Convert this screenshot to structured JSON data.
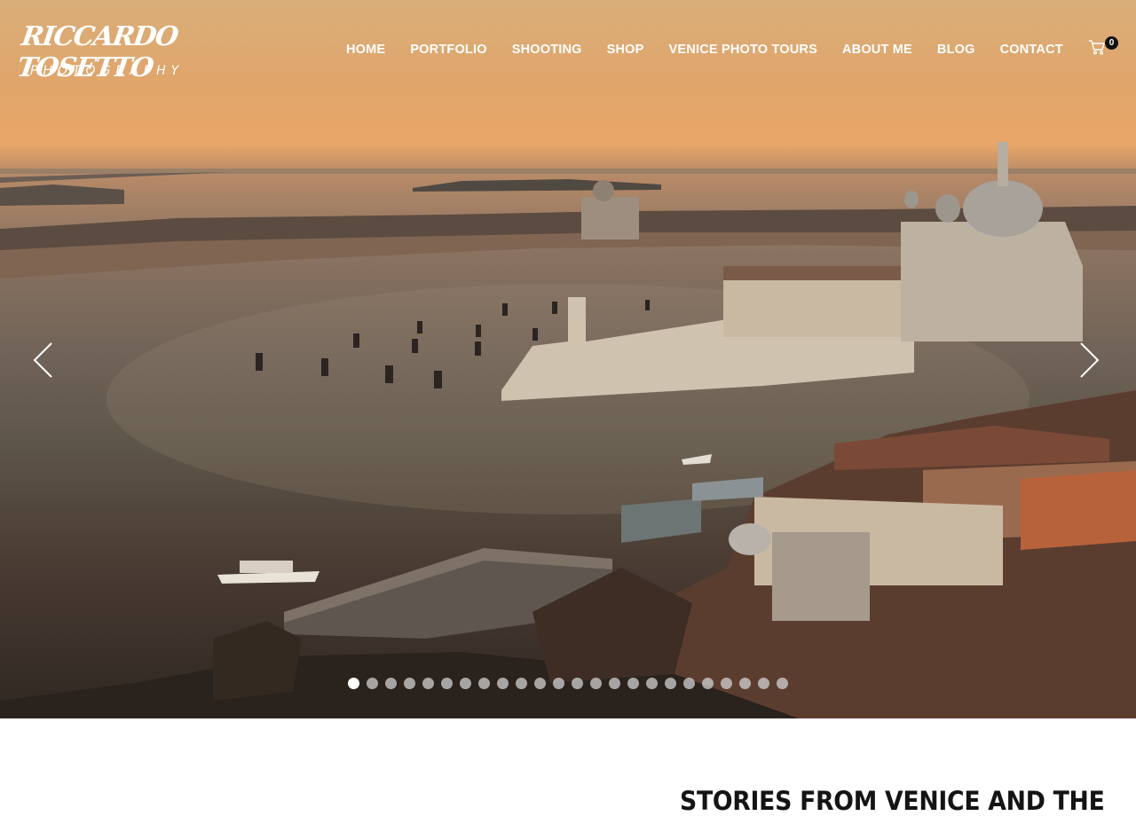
{
  "logo": {
    "line1": "RICCARDO TOSETTO",
    "line2": "PHOTOGRAPHY"
  },
  "nav": {
    "items": [
      {
        "label": "HOME"
      },
      {
        "label": "PORTFOLIO"
      },
      {
        "label": "SHOOTING"
      },
      {
        "label": "SHOP"
      },
      {
        "label": "VENICE PHOTO TOURS"
      },
      {
        "label": "ABOUT ME"
      },
      {
        "label": "BLOG"
      },
      {
        "label": "CONTACT"
      }
    ]
  },
  "cart": {
    "icon": "cart-icon",
    "count": "0"
  },
  "slider": {
    "prev_icon": "chevron-left-icon",
    "next_icon": "chevron-right-icon",
    "total_slides": 24,
    "active_slide": 1
  },
  "intro": {
    "heading": "STORIES FROM VENICE AND THE"
  },
  "colors": {
    "sky": "#e0a56b",
    "water": "#6f6257",
    "text_dark": "#141414",
    "nav_text": "#ffffff"
  }
}
